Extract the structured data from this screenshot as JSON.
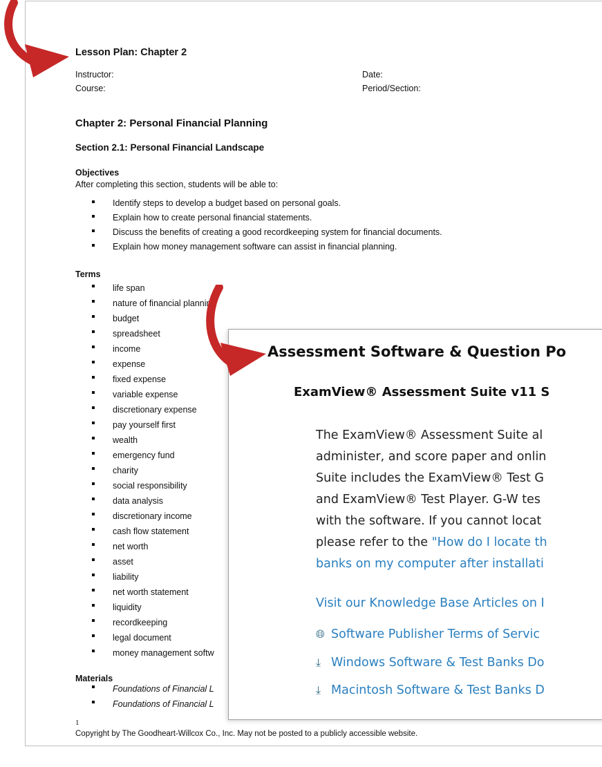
{
  "document": {
    "lesson_title": "Lesson Plan: Chapter 2",
    "instructor_label": "Instructor:",
    "course_label": "Course:",
    "date_label": "Date:",
    "period_label": "Period/Section:",
    "chapter_title": "Chapter 2: Personal Financial Planning",
    "section_title": "Section 2.1: Personal Financial Landscape",
    "objectives_heading": "Objectives",
    "objectives_intro": "After completing this section, students will be able to:",
    "objectives": [
      "Identify steps to develop a budget based on personal goals.",
      "Explain how to create personal financial statements.",
      "Discuss the benefits of creating a good recordkeeping system for financial documents.",
      "Explain how money management software can assist in financial planning."
    ],
    "terms_heading": "Terms",
    "terms": [
      "life span",
      "nature of financial planning",
      "budget",
      "spreadsheet",
      "income",
      "expense",
      "fixed expense",
      "variable expense",
      "discretionary expense",
      "pay yourself first",
      "wealth",
      "emergency fund",
      "charity",
      "social responsibility",
      "data analysis",
      "discretionary income",
      "cash flow statement",
      "net worth",
      "asset",
      "liability",
      "net worth statement",
      "liquidity",
      "recordkeeping",
      "legal document",
      "money management softw"
    ],
    "materials_heading": "Materials",
    "materials": [
      "Foundations of Financial L",
      "Foundations of Financial L"
    ],
    "page_number": "1",
    "copyright": "Copyright by The Goodheart-Willcox Co., Inc. May not be posted to a publicly accessible website."
  },
  "overlay": {
    "title": "Assessment Software & Question Po",
    "subtitle": "ExamView® Assessment Suite v11 S",
    "body_lines": [
      "The ExamView® Assessment Suite al",
      "administer, and score paper and onlin",
      "Suite includes the ExamView® Test G",
      "and ExamView® Test Player. G-W tes",
      "with the software. If you cannot locat"
    ],
    "body_line6_prefix": "please refer to the ",
    "body_line6_link": "\"How do I locate th",
    "body_line7_link": "banks on my computer after installati",
    "kb_link": "Visit our Knowledge Base Articles on I",
    "links": [
      {
        "label": "Software Publisher Terms of Servic",
        "icon": "globe-icon"
      },
      {
        "label": "Windows Software & Test Banks Do",
        "icon": "download-icon"
      },
      {
        "label": "Macintosh Software & Test Banks D",
        "icon": "download-icon"
      }
    ]
  },
  "colors": {
    "arrow": "#c62828",
    "link": "#2a7fbf"
  }
}
